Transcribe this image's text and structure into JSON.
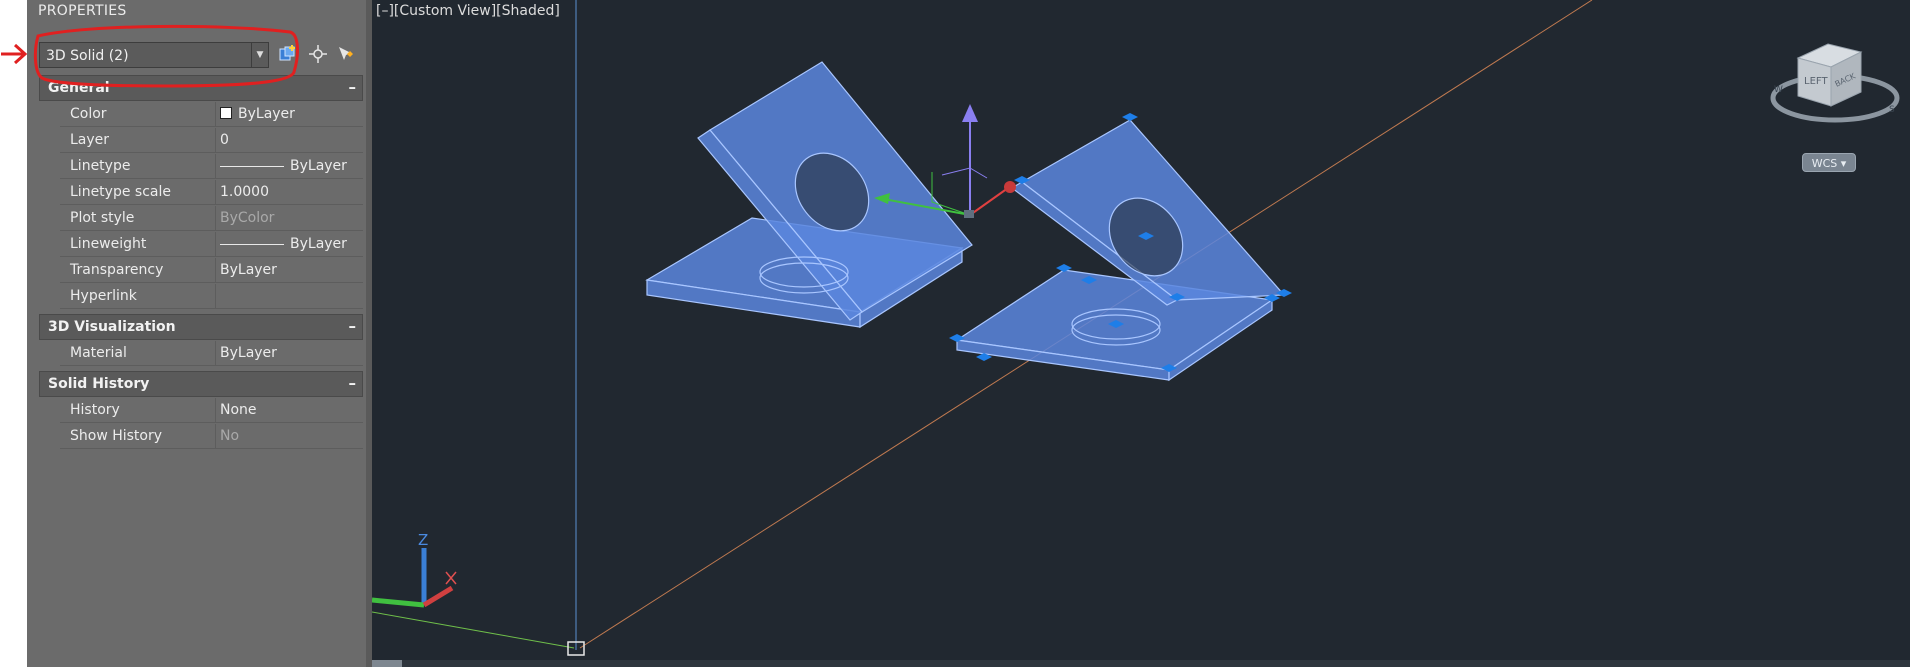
{
  "palette": {
    "title": "PROPERTIES",
    "selection": {
      "value": "3D Solid (2)"
    },
    "toolbar": [
      {
        "icon": "toggle-pickadd-icon"
      },
      {
        "icon": "select-objects-icon"
      },
      {
        "icon": "quick-select-icon"
      }
    ],
    "sections": {
      "general": {
        "title": "General",
        "toggle": "–",
        "rows": [
          {
            "name": "Color",
            "value": "ByLayer",
            "swatch": "#ffffff"
          },
          {
            "name": "Layer",
            "value": "0"
          },
          {
            "name": "Linetype",
            "value": "ByLayer"
          },
          {
            "name": "Linetype scale",
            "value": "1.0000"
          },
          {
            "name": "Plot style",
            "value": "ByColor"
          },
          {
            "name": "Lineweight",
            "value": "ByLayer"
          },
          {
            "name": "Transparency",
            "value": "ByLayer"
          },
          {
            "name": "Hyperlink",
            "value": ""
          }
        ]
      },
      "visualization": {
        "title": "3D Visualization",
        "toggle": "–",
        "rows": [
          {
            "name": "Material",
            "value": "ByLayer"
          }
        ]
      },
      "history": {
        "title": "Solid History",
        "toggle": "–",
        "rows": [
          {
            "name": "History",
            "value": "None"
          },
          {
            "name": "Show History",
            "value": "No"
          }
        ]
      }
    }
  },
  "viewport": {
    "view_controls": "[–][Custom View][Shaded]",
    "viewcube": {
      "face": "LEFT",
      "side": "BACK",
      "compass": [
        "W",
        "S"
      ]
    },
    "wcs_label": "WCS",
    "ucs_icon": {
      "z": "Z"
    }
  },
  "colors": {
    "annotation": "#e02020",
    "selected_solid": "#5b86de",
    "grip": "#1e7ee8",
    "viewport_bg": "#212830",
    "panel_bg": "#6b6b6b"
  }
}
